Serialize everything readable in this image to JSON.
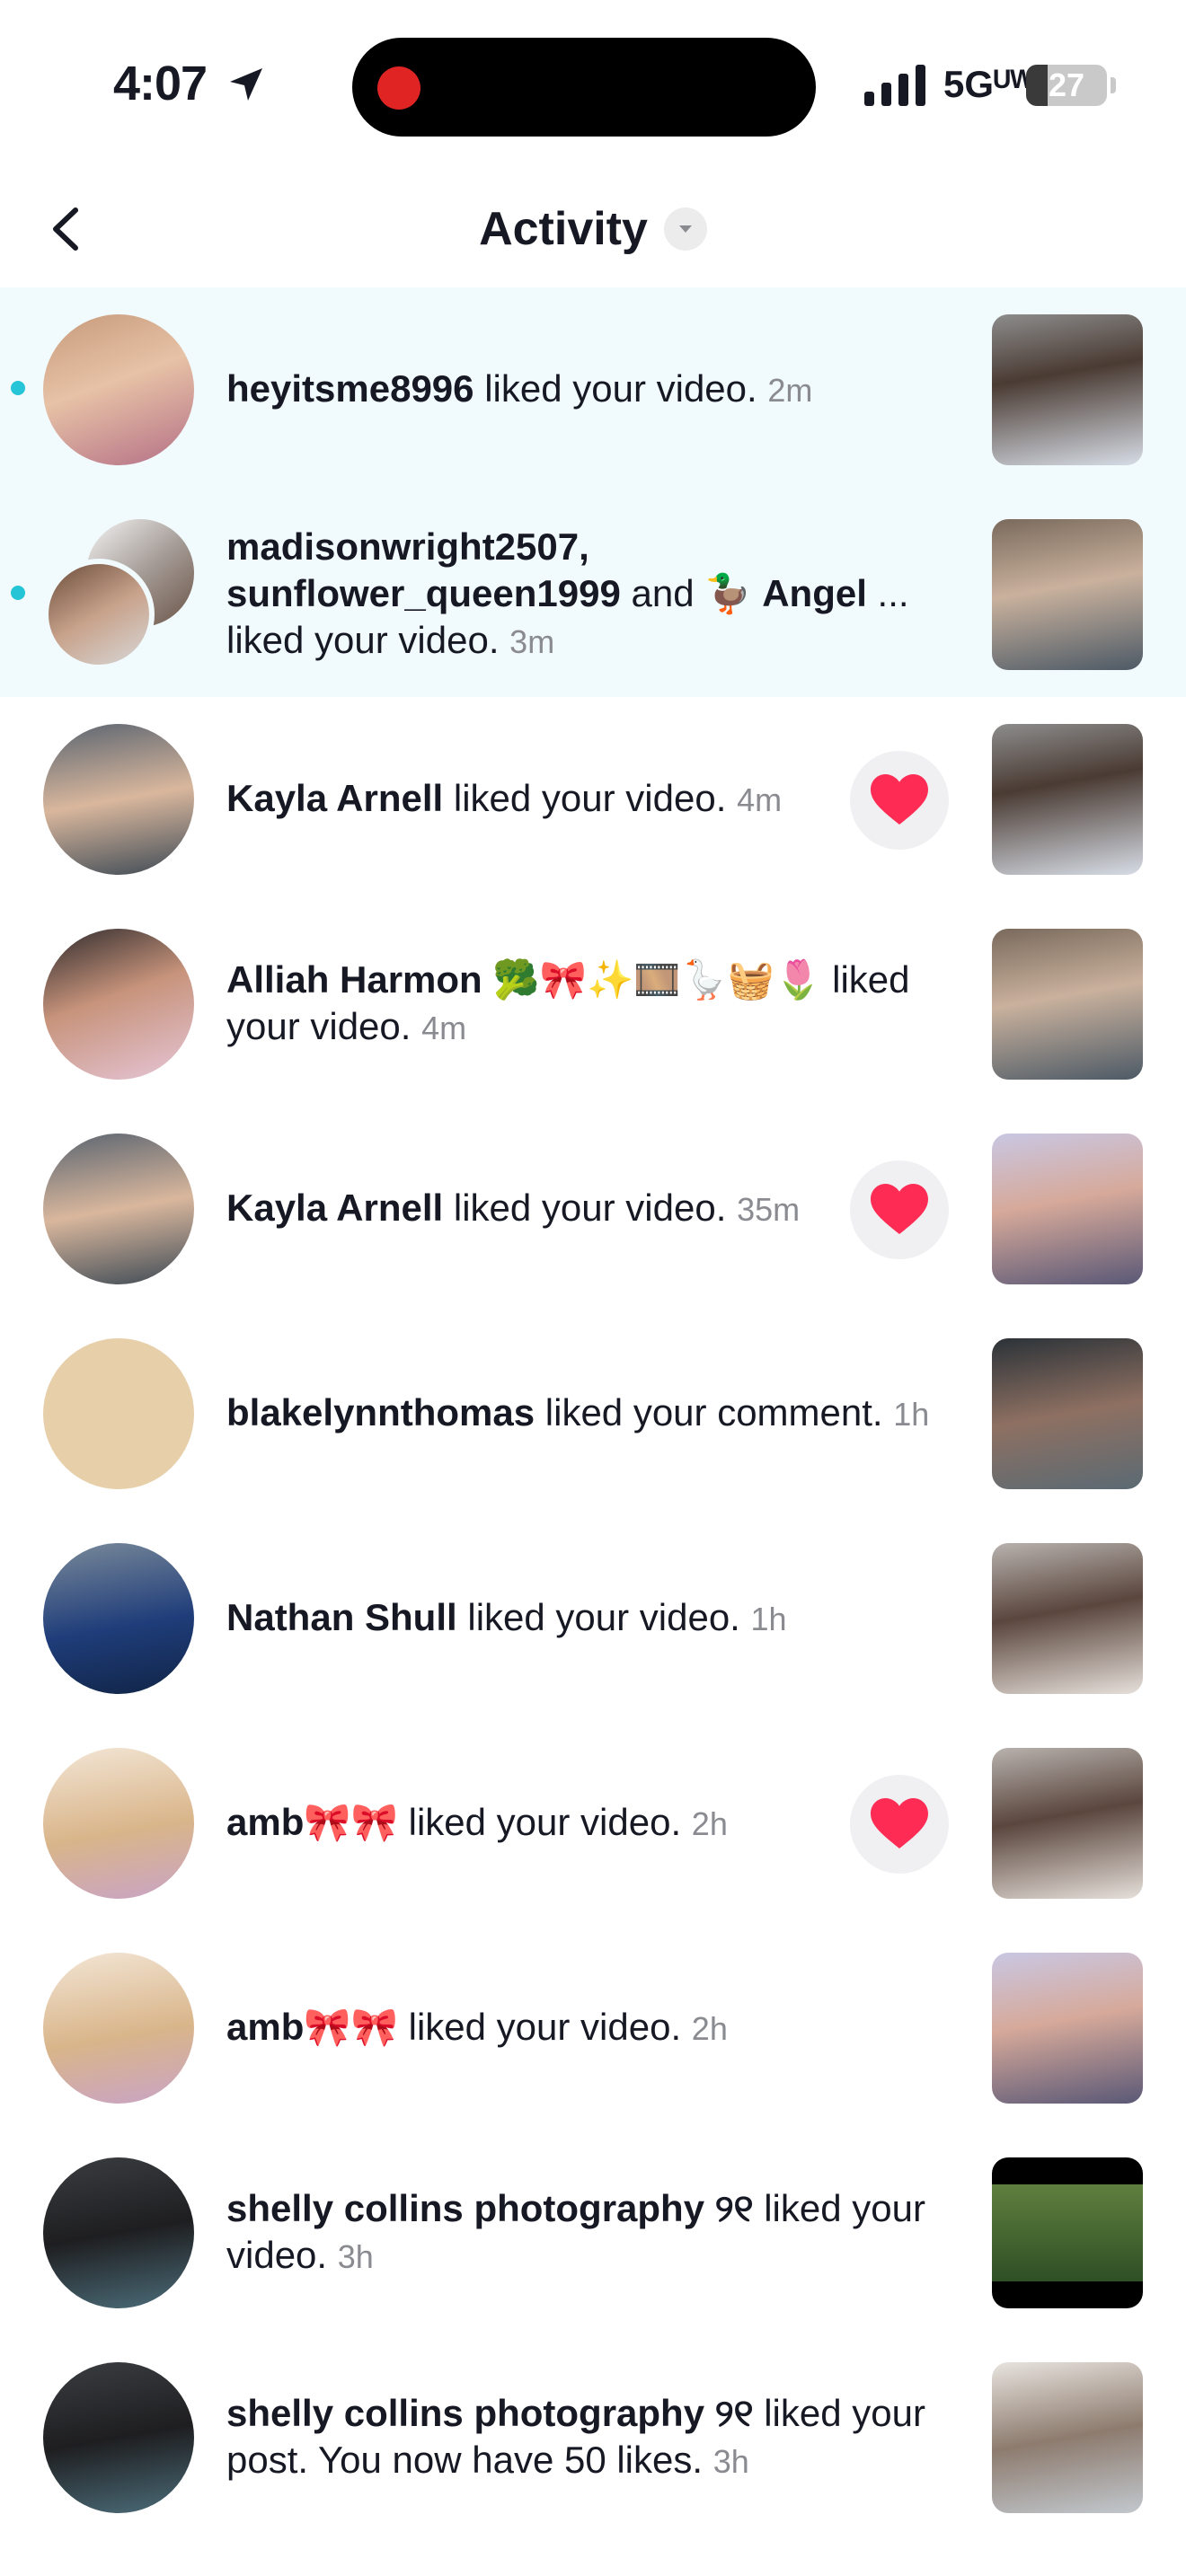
{
  "status_bar": {
    "time": "4:07",
    "network": "5Gᵁᵂ",
    "battery": "27",
    "battery_level": 0.27,
    "recording": true
  },
  "header": {
    "title": "Activity",
    "back_icon": "chevron-left-icon",
    "dropdown_icon": "chevron-down-icon"
  },
  "accent": {
    "unread_bg": "#f1fafd",
    "unread_dot": "#25c4d6",
    "heart": "#fe2c55"
  },
  "notifications": [
    {
      "unread": true,
      "parts": [
        {
          "t": "heyitsme8996",
          "b": true
        },
        {
          "t": " liked your video. "
        }
      ],
      "time": "2m",
      "heart": false
    },
    {
      "unread": true,
      "stacked": true,
      "parts": [
        {
          "t": "madisonwright2507,",
          "b": true
        },
        {
          "t": " "
        },
        {
          "t": "sunflower_queen1999",
          "b": true
        },
        {
          "t": " and 🦆 "
        },
        {
          "t": "Angel",
          "b": true
        },
        {
          "t": " ... liked your video. "
        }
      ],
      "time": "3m",
      "heart": false
    },
    {
      "unread": false,
      "parts": [
        {
          "t": "Kayla Arnell",
          "b": true
        },
        {
          "t": " liked your video. "
        }
      ],
      "time": "4m",
      "heart": true
    },
    {
      "unread": false,
      "parts": [
        {
          "t": "Alliah Harmon",
          "b": true
        },
        {
          "t": " 🥦🎀✨🎞️🪿🧺🌷 liked your video. "
        }
      ],
      "time": "4m",
      "heart": false
    },
    {
      "unread": false,
      "parts": [
        {
          "t": "Kayla Arnell",
          "b": true
        },
        {
          "t": " liked your video. "
        }
      ],
      "time": "35m",
      "heart": true
    },
    {
      "unread": false,
      "parts": [
        {
          "t": "blakelynnthomas",
          "b": true
        },
        {
          "t": " liked your comment. "
        }
      ],
      "time": "1h",
      "heart": false
    },
    {
      "unread": false,
      "parts": [
        {
          "t": "Nathan Shull",
          "b": true
        },
        {
          "t": " liked your video. "
        }
      ],
      "time": "1h",
      "heart": false
    },
    {
      "unread": false,
      "parts": [
        {
          "t": "amb🎀🎀",
          "b": true
        },
        {
          "t": " liked your video. "
        }
      ],
      "time": "2h",
      "heart": true
    },
    {
      "unread": false,
      "parts": [
        {
          "t": "amb🎀🎀",
          "b": true
        },
        {
          "t": " liked your video. "
        }
      ],
      "time": "2h",
      "heart": false
    },
    {
      "unread": false,
      "parts": [
        {
          "t": "shelly collins photography ୨୧",
          "b": true
        },
        {
          "t": " liked your video. "
        }
      ],
      "time": "3h",
      "heart": false
    },
    {
      "unread": false,
      "parts": [
        {
          "t": "shelly collins photography ୨୧",
          "b": true
        },
        {
          "t": " liked your post. You now have 50 likes. "
        }
      ],
      "time": "3h",
      "heart": false
    }
  ]
}
